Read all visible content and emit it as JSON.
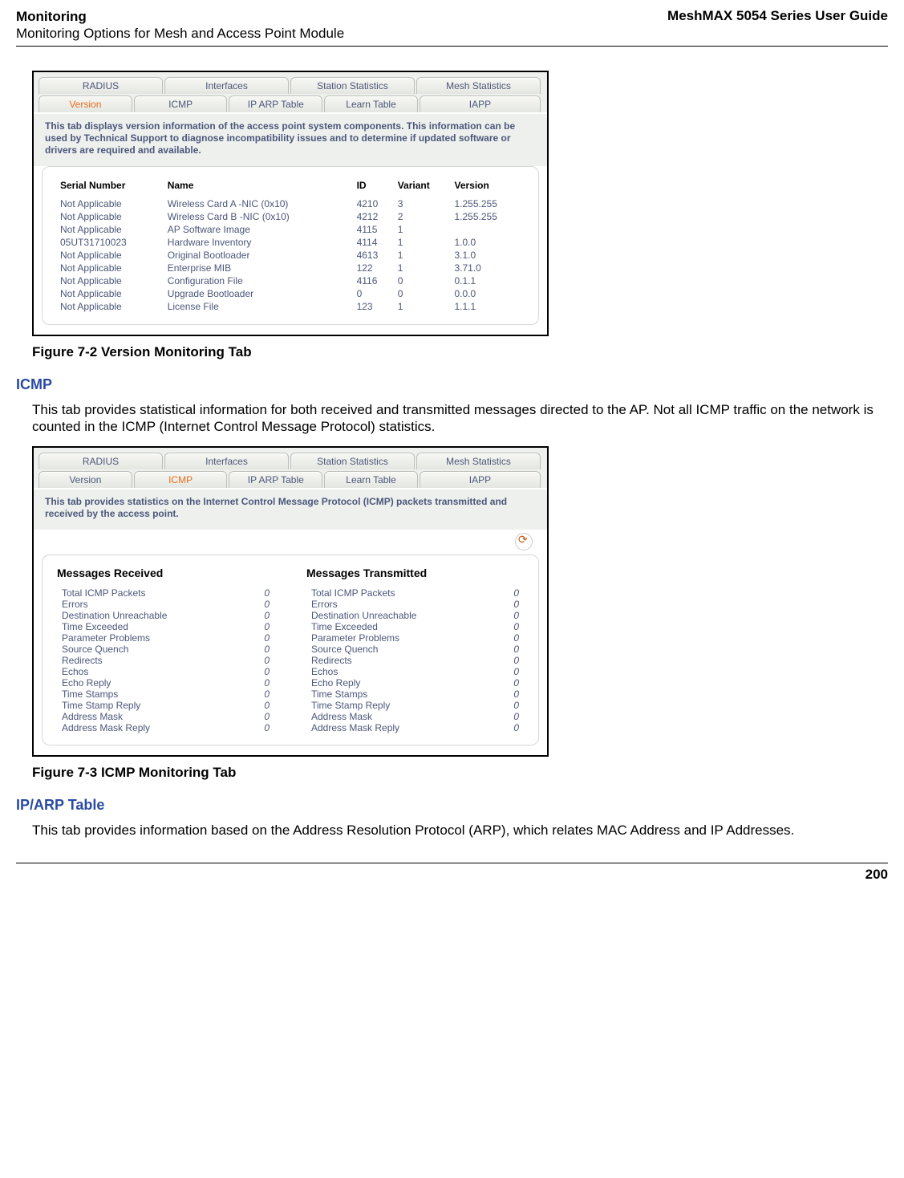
{
  "header": {
    "left_top": "Monitoring",
    "left_sub": "Monitoring Options for Mesh and Access Point Module",
    "right": "MeshMAX 5054 Series User Guide"
  },
  "fig1": {
    "tabs_top": [
      "RADIUS",
      "Interfaces",
      "Station Statistics",
      "Mesh Statistics"
    ],
    "tabs_bot": [
      "Version",
      "ICMP",
      "IP ARP Table",
      "Learn Table",
      "IAPP"
    ],
    "help": "This tab displays version information of the access point system components. This information can be used by Technical Support to diagnose incompatibility issues and to determine if updated software or drivers are required and available.",
    "cols": [
      "Serial Number",
      "Name",
      "ID",
      "Variant",
      "Version"
    ],
    "rows": [
      [
        "Not Applicable",
        "Wireless Card A -NIC (0x10)",
        "4210",
        "3",
        "1.255.255"
      ],
      [
        "Not Applicable",
        "Wireless Card B -NIC (0x10)",
        "4212",
        "2",
        "1.255.255"
      ],
      [
        "Not Applicable",
        "AP Software Image",
        "4115",
        "1",
        ""
      ],
      [
        "05UT31710023",
        "Hardware Inventory",
        "4114",
        "1",
        "1.0.0"
      ],
      [
        "Not Applicable",
        "Original Bootloader",
        "4613",
        "1",
        "3.1.0"
      ],
      [
        "Not Applicable",
        "Enterprise MIB",
        "122",
        "1",
        "3.71.0"
      ],
      [
        "Not Applicable",
        "Configuration File",
        "4116",
        "0",
        "0.1.1"
      ],
      [
        "Not Applicable",
        "Upgrade Bootloader",
        "0",
        "0",
        "0.0.0"
      ],
      [
        "Not Applicable",
        "License File",
        "123",
        "1",
        "1.1.1"
      ]
    ],
    "caption": "Figure 7-2 Version Monitoring Tab"
  },
  "sec_icmp": {
    "title": "ICMP",
    "body": "This tab provides statistical information for both received and transmitted messages directed to the AP. Not all ICMP traffic on the network is counted in the ICMP (Internet Control Message Protocol) statistics."
  },
  "fig2": {
    "tabs_top": [
      "RADIUS",
      "Interfaces",
      "Station Statistics",
      "Mesh Statistics"
    ],
    "tabs_bot": [
      "Version",
      "ICMP",
      "IP ARP Table",
      "Learn Table",
      "IAPP"
    ],
    "help": "This tab provides statistics on the Internet Control Message Protocol (ICMP) packets transmitted and received by the access point.",
    "rx_title": "Messages Received",
    "tx_title": "Messages Transmitted",
    "metrics": [
      "Total ICMP Packets",
      "Errors",
      "Destination Unreachable",
      "Time Exceeded",
      "Parameter Problems",
      "Source Quench",
      "Redirects",
      "Echos",
      "Echo Reply",
      "Time Stamps",
      "Time Stamp Reply",
      "Address Mask",
      "Address Mask Reply"
    ],
    "rx_values": [
      "0",
      "0",
      "0",
      "0",
      "0",
      "0",
      "0",
      "0",
      "0",
      "0",
      "0",
      "0",
      "0"
    ],
    "tx_values": [
      "0",
      "0",
      "0",
      "0",
      "0",
      "0",
      "0",
      "0",
      "0",
      "0",
      "0",
      "0",
      "0"
    ],
    "caption": "Figure 7-3 ICMP Monitoring Tab"
  },
  "sec_iparp": {
    "title": "IP/ARP Table",
    "body": "This tab provides information based on the Address Resolution Protocol (ARP), which relates MAC Address and IP Addresses."
  },
  "page_number": "200"
}
